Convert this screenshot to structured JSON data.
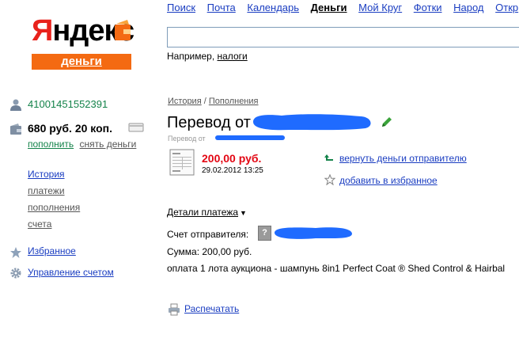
{
  "logo": {
    "brand_first": "Я",
    "brand_rest": "ндекс",
    "service": "деньги"
  },
  "topnav": {
    "items": [
      "Поиск",
      "Почта",
      "Календарь",
      "Деньги",
      "Мой Круг",
      "Фотки",
      "Народ",
      "Откр"
    ],
    "active": "Деньги"
  },
  "search": {
    "value": "",
    "hint_prefix": "Например,",
    "hint_link": "налоги"
  },
  "account": {
    "number": "41001451552391",
    "balance": "680 руб. 20 коп.",
    "topup_label": "пополнить",
    "withdraw_label": "снять деньги"
  },
  "sidebar": {
    "history": "История",
    "payments": "платежи",
    "topups": "пополнения",
    "invoices": "счета",
    "favorites": "Избранное",
    "account_mgmt": "Управление счетом"
  },
  "operation": {
    "breadcrumb_history": "История",
    "breadcrumb_sep": " / ",
    "breadcrumb_topups": "Пополнения",
    "title": "Перевод от",
    "subtitle": "Перевод от",
    "amount": "200,00 руб.",
    "datetime": "29.02.2012 13:25",
    "return_label": "вернуть деньги отправителю",
    "add_fav_label": "добавить в избранное"
  },
  "details": {
    "header": "Детали платежа",
    "sender_label": "Счет отправителя:",
    "sum_line": "Сумма: 200,00 руб.",
    "purpose": "оплата 1 лота аукциона - шампунь 8in1 Perfect Coat ® Shed Control & Hairbal",
    "print_label": "Распечатать"
  },
  "colors": {
    "brand_red": "#e8221c",
    "brand_orange": "#f46a12",
    "link_blue": "#1a3dc1",
    "green": "#14834a",
    "amount_red": "#e30613",
    "redaction_blue": "#1f6bff"
  }
}
